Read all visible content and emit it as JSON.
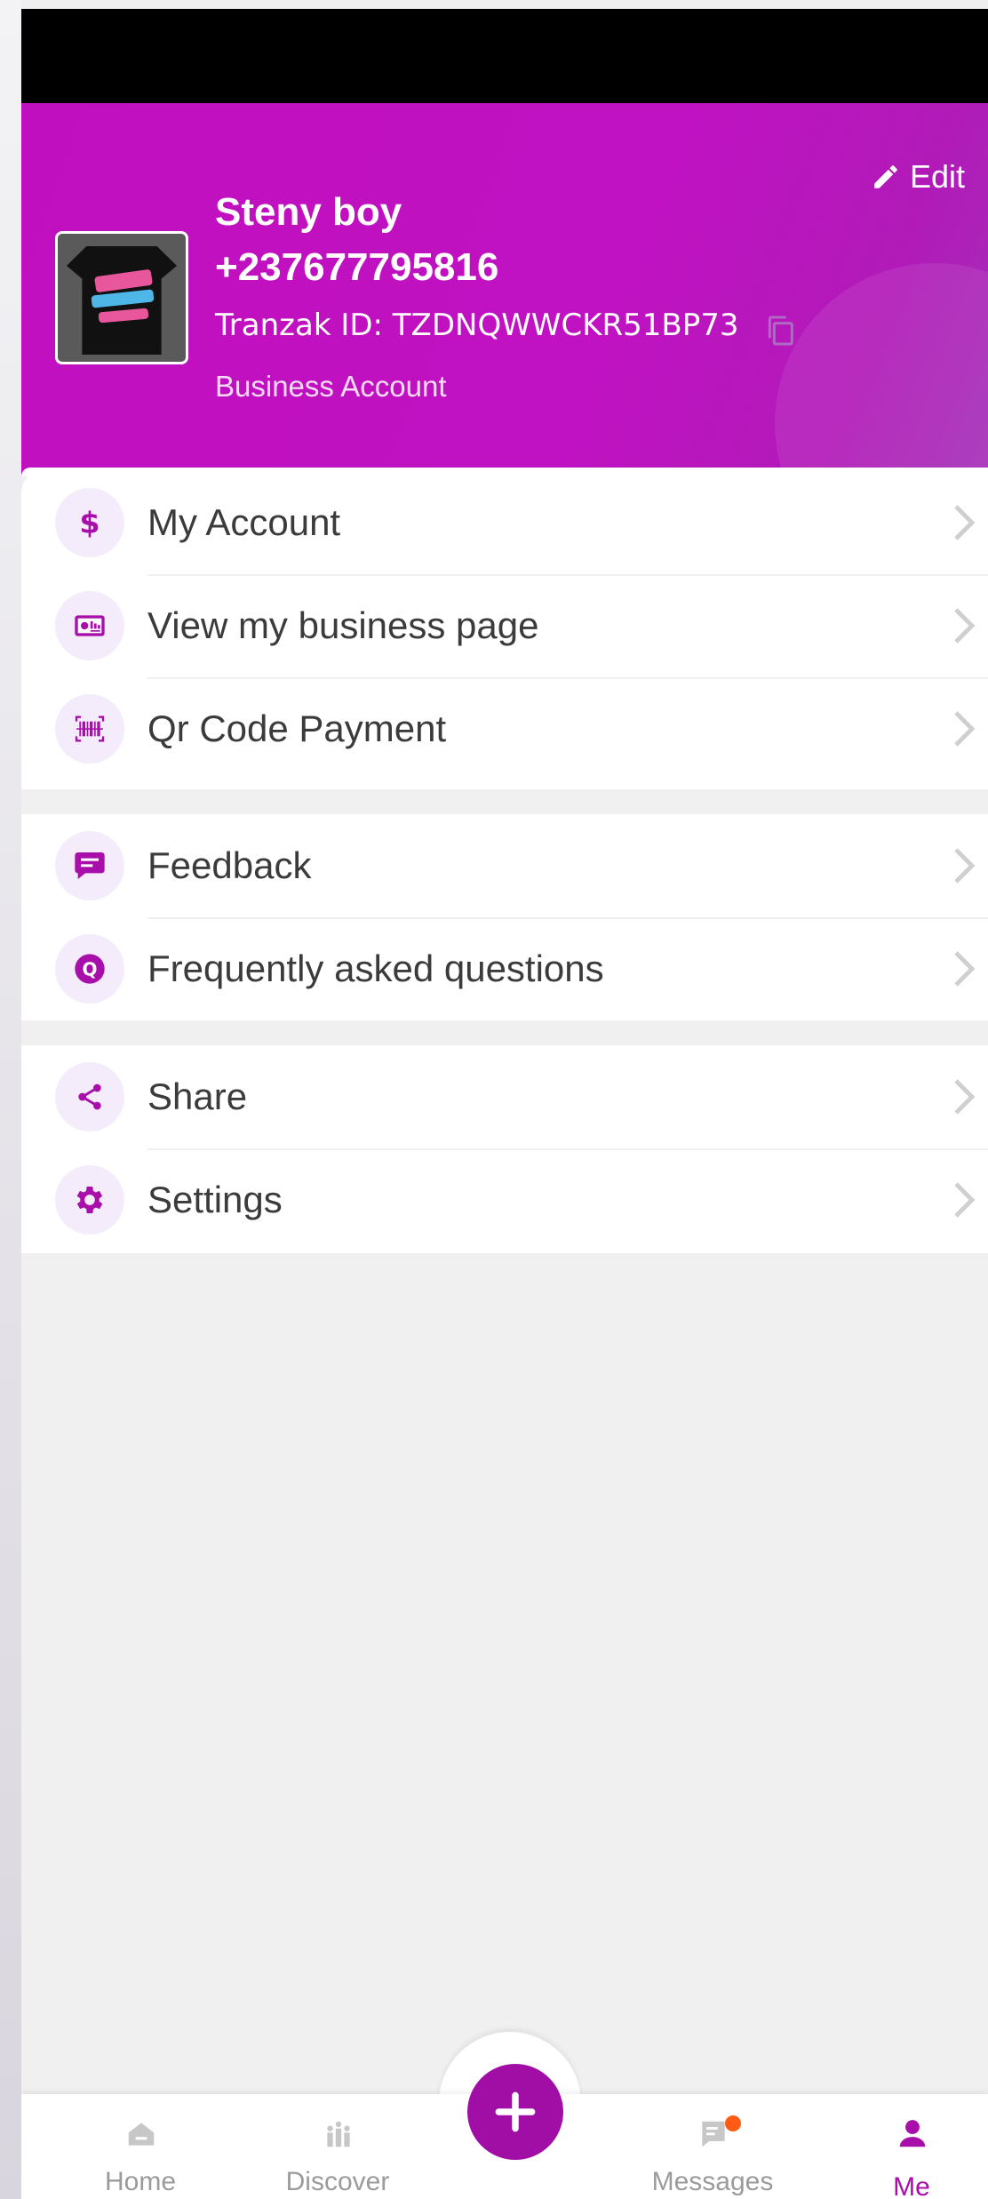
{
  "header": {
    "edit_label": "Edit",
    "name": "Steny boy",
    "phone": "+237677795816",
    "tranzak_id": "Tranzak ID: TZDNQWWCKR51BP73",
    "account_type": "Business Account"
  },
  "menu_groups": [
    [
      {
        "label": "My Account",
        "icon": "dollar-icon"
      },
      {
        "label": "View my business page",
        "icon": "business-card-icon"
      },
      {
        "label": "Qr Code Payment",
        "icon": "barcode-icon"
      }
    ],
    [
      {
        "label": "Feedback",
        "icon": "feedback-icon"
      },
      {
        "label": "Frequently asked questions",
        "icon": "faq-icon"
      }
    ],
    [
      {
        "label": "Share",
        "icon": "share-icon"
      },
      {
        "label": "Settings",
        "icon": "gear-icon"
      }
    ]
  ],
  "nav": {
    "home": "Home",
    "discover": "Discover",
    "messages": "Messages",
    "me": "Me",
    "active": "Me"
  },
  "colors": {
    "brand": "#c010c0",
    "accent": "#a00ea5",
    "badge": "#ff5b14"
  }
}
